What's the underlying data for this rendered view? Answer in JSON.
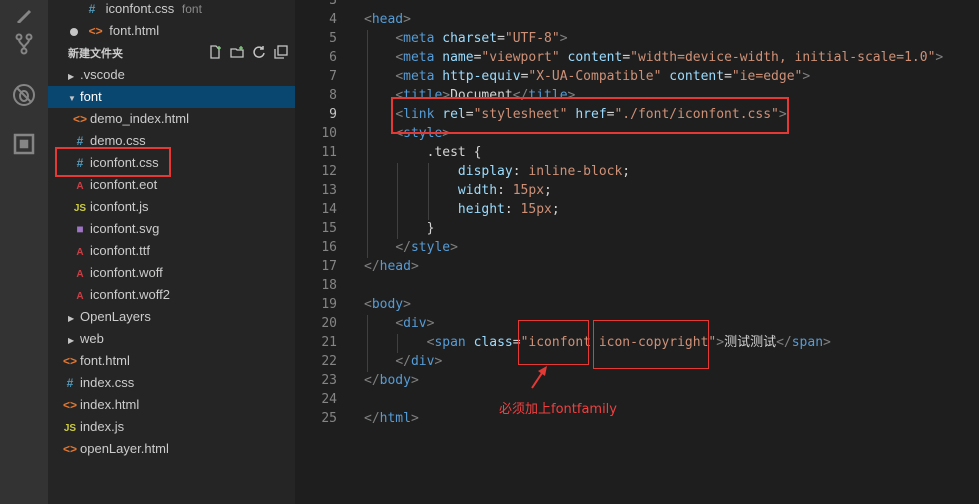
{
  "activity_bar": {
    "icons": [
      "explorer-icon",
      "source-control-icon",
      "debug-icon",
      "extensions-icon"
    ]
  },
  "explorer": {
    "open_editors": [
      {
        "icon": "#",
        "name": "iconfont.css",
        "desc": "font"
      },
      {
        "icon": "<>",
        "name": "font.html",
        "desc": ""
      }
    ],
    "section_title": "新建文件夹",
    "tree": [
      {
        "type": "folder",
        "name": ".vscode",
        "expanded": false,
        "indent": 1
      },
      {
        "type": "folder",
        "name": "font",
        "expanded": true,
        "indent": 1,
        "active": true
      },
      {
        "icon": "<>",
        "name": "demo_index.html",
        "indent": 2
      },
      {
        "icon": "#",
        "name": "demo.css",
        "indent": 2
      },
      {
        "icon": "#",
        "name": "iconfont.css",
        "indent": 2
      },
      {
        "icon": "A",
        "name": "iconfont.eot",
        "indent": 2
      },
      {
        "icon": "JS",
        "name": "iconfont.js",
        "indent": 2
      },
      {
        "icon": "svg",
        "name": "iconfont.svg",
        "indent": 2
      },
      {
        "icon": "A",
        "name": "iconfont.ttf",
        "indent": 2
      },
      {
        "icon": "A",
        "name": "iconfont.woff",
        "indent": 2
      },
      {
        "icon": "A",
        "name": "iconfont.woff2",
        "indent": 2
      },
      {
        "type": "folder",
        "name": "OpenLayers",
        "expanded": false,
        "indent": 1
      },
      {
        "type": "folder",
        "name": "web",
        "expanded": false,
        "indent": 1
      },
      {
        "icon": "<>",
        "name": "font.html",
        "indent": 1
      },
      {
        "icon": "#",
        "name": "index.css",
        "indent": 1
      },
      {
        "icon": "<>",
        "name": "index.html",
        "indent": 1
      },
      {
        "icon": "JS",
        "name": "index.js",
        "indent": 1
      },
      {
        "icon": "<>",
        "name": "openLayer.html",
        "indent": 1
      }
    ]
  },
  "editor": {
    "current_line": "9",
    "lines": [
      {
        "n": "3",
        "parts": []
      },
      {
        "n": "4",
        "parts": [
          [
            "pl",
            "<"
          ],
          [
            "tg",
            "head"
          ],
          [
            "pl",
            ">"
          ]
        ]
      },
      {
        "n": "5",
        "parts": [
          [
            "tx",
            "    "
          ],
          [
            "pl",
            "<"
          ],
          [
            "tg",
            "meta"
          ],
          [
            "tx",
            " "
          ],
          [
            "at",
            "charset"
          ],
          [
            "tx",
            "="
          ],
          [
            "st",
            "\"UTF-8\""
          ],
          [
            "pl",
            ">"
          ]
        ]
      },
      {
        "n": "6",
        "parts": [
          [
            "tx",
            "    "
          ],
          [
            "pl",
            "<"
          ],
          [
            "tg",
            "meta"
          ],
          [
            "tx",
            " "
          ],
          [
            "at",
            "name"
          ],
          [
            "tx",
            "="
          ],
          [
            "st",
            "\"viewport\""
          ],
          [
            "tx",
            " "
          ],
          [
            "at",
            "content"
          ],
          [
            "tx",
            "="
          ],
          [
            "st",
            "\"width=device-width, initial-scale=1.0\""
          ],
          [
            "pl",
            ">"
          ]
        ]
      },
      {
        "n": "7",
        "parts": [
          [
            "tx",
            "    "
          ],
          [
            "pl",
            "<"
          ],
          [
            "tg",
            "meta"
          ],
          [
            "tx",
            " "
          ],
          [
            "at",
            "http-equiv"
          ],
          [
            "tx",
            "="
          ],
          [
            "st",
            "\"X-UA-Compatible\""
          ],
          [
            "tx",
            " "
          ],
          [
            "at",
            "content"
          ],
          [
            "tx",
            "="
          ],
          [
            "st",
            "\"ie=edge\""
          ],
          [
            "pl",
            ">"
          ]
        ]
      },
      {
        "n": "8",
        "parts": [
          [
            "tx",
            "    "
          ],
          [
            "pl",
            "<"
          ],
          [
            "tg",
            "title"
          ],
          [
            "pl",
            ">"
          ],
          [
            "tx",
            "Document"
          ],
          [
            "pl",
            "</"
          ],
          [
            "tg",
            "title"
          ],
          [
            "pl",
            ">"
          ]
        ]
      },
      {
        "n": "9",
        "parts": [
          [
            "tx",
            "    "
          ],
          [
            "pl",
            "<"
          ],
          [
            "tg",
            "link"
          ],
          [
            "tx",
            " "
          ],
          [
            "at",
            "rel"
          ],
          [
            "tx",
            "="
          ],
          [
            "st",
            "\"stylesheet\""
          ],
          [
            "tx",
            " "
          ],
          [
            "at",
            "href"
          ],
          [
            "tx",
            "="
          ],
          [
            "st",
            "\"./font/iconfont.css\""
          ],
          [
            "pl",
            ">"
          ]
        ]
      },
      {
        "n": "10",
        "parts": [
          [
            "tx",
            "    "
          ],
          [
            "pl",
            "<"
          ],
          [
            "tg",
            "style"
          ],
          [
            "pl",
            ">"
          ]
        ]
      },
      {
        "n": "11",
        "parts": [
          [
            "tx",
            "        .test {"
          ]
        ]
      },
      {
        "n": "12",
        "parts": [
          [
            "tx",
            "            "
          ],
          [
            "at",
            "display"
          ],
          [
            "tx",
            ": "
          ],
          [
            "st",
            "inline-block"
          ],
          [
            "tx",
            ";"
          ]
        ]
      },
      {
        "n": "13",
        "parts": [
          [
            "tx",
            "            "
          ],
          [
            "at",
            "width"
          ],
          [
            "tx",
            ": "
          ],
          [
            "st",
            "15px"
          ],
          [
            "tx",
            ";"
          ]
        ]
      },
      {
        "n": "14",
        "parts": [
          [
            "tx",
            "            "
          ],
          [
            "at",
            "height"
          ],
          [
            "tx",
            ": "
          ],
          [
            "st",
            "15px"
          ],
          [
            "tx",
            ";"
          ]
        ]
      },
      {
        "n": "15",
        "parts": [
          [
            "tx",
            "        }"
          ]
        ]
      },
      {
        "n": "16",
        "parts": [
          [
            "tx",
            "    "
          ],
          [
            "pl",
            "</"
          ],
          [
            "tg",
            "style"
          ],
          [
            "pl",
            ">"
          ]
        ]
      },
      {
        "n": "17",
        "parts": [
          [
            "pl",
            "</"
          ],
          [
            "tg",
            "head"
          ],
          [
            "pl",
            ">"
          ]
        ]
      },
      {
        "n": "18",
        "parts": []
      },
      {
        "n": "19",
        "parts": [
          [
            "pl",
            "<"
          ],
          [
            "tg",
            "body"
          ],
          [
            "pl",
            ">"
          ]
        ]
      },
      {
        "n": "20",
        "parts": [
          [
            "tx",
            "    "
          ],
          [
            "pl",
            "<"
          ],
          [
            "tg",
            "div"
          ],
          [
            "pl",
            ">"
          ]
        ]
      },
      {
        "n": "21",
        "parts": [
          [
            "tx",
            "        "
          ],
          [
            "pl",
            "<"
          ],
          [
            "tg",
            "span"
          ],
          [
            "tx",
            " "
          ],
          [
            "at",
            "class"
          ],
          [
            "tx",
            "="
          ],
          [
            "st",
            "\"iconfont icon-copyright\""
          ],
          [
            "pl",
            ">"
          ],
          [
            "tx",
            "测试测试"
          ],
          [
            "pl",
            "</"
          ],
          [
            "tg",
            "span"
          ],
          [
            "pl",
            ">"
          ]
        ]
      },
      {
        "n": "22",
        "parts": [
          [
            "tx",
            "    "
          ],
          [
            "pl",
            "</"
          ],
          [
            "tg",
            "div"
          ],
          [
            "pl",
            ">"
          ]
        ]
      },
      {
        "n": "23",
        "parts": [
          [
            "pl",
            "</"
          ],
          [
            "tg",
            "body"
          ],
          [
            "pl",
            ">"
          ]
        ]
      },
      {
        "n": "24",
        "parts": []
      },
      {
        "n": "25",
        "parts": [
          [
            "pl",
            "</"
          ],
          [
            "tg",
            "html"
          ],
          [
            "pl",
            ">"
          ]
        ]
      }
    ],
    "annotation": "必须加上fontfamily"
  },
  "colors": {
    "highlight_box": "#e53935",
    "tag": "#569cd6",
    "attribute": "#9cdcfe",
    "string": "#ce9178",
    "active_row": "#094771"
  }
}
